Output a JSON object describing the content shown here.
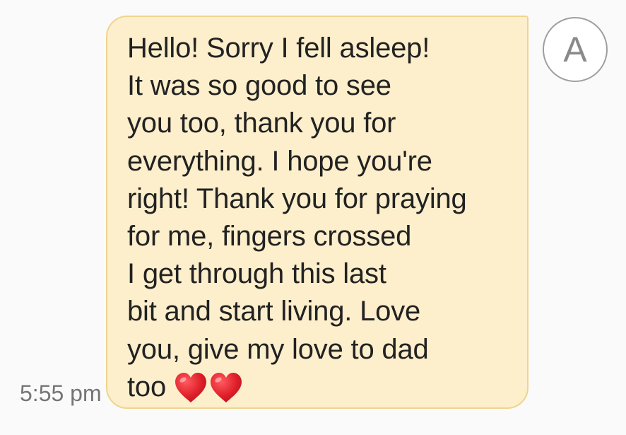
{
  "message": {
    "lines": [
      "Hello! Sorry I fell asleep!",
      "It was so good to see",
      "you too, thank you for",
      "everything. I hope you're",
      "right! Thank you for praying",
      "for me, fingers crossed",
      "I get through this last",
      "bit and start living. Love",
      "you, give my love to dad",
      "too"
    ],
    "emoji": [
      "red-heart",
      "red-heart"
    ],
    "timestamp": "5:55 pm"
  },
  "avatar": {
    "initial": "A"
  },
  "colors": {
    "bubble_fill": "#fdefcc",
    "bubble_border": "#f0d48e",
    "heart": "#e0202a"
  }
}
